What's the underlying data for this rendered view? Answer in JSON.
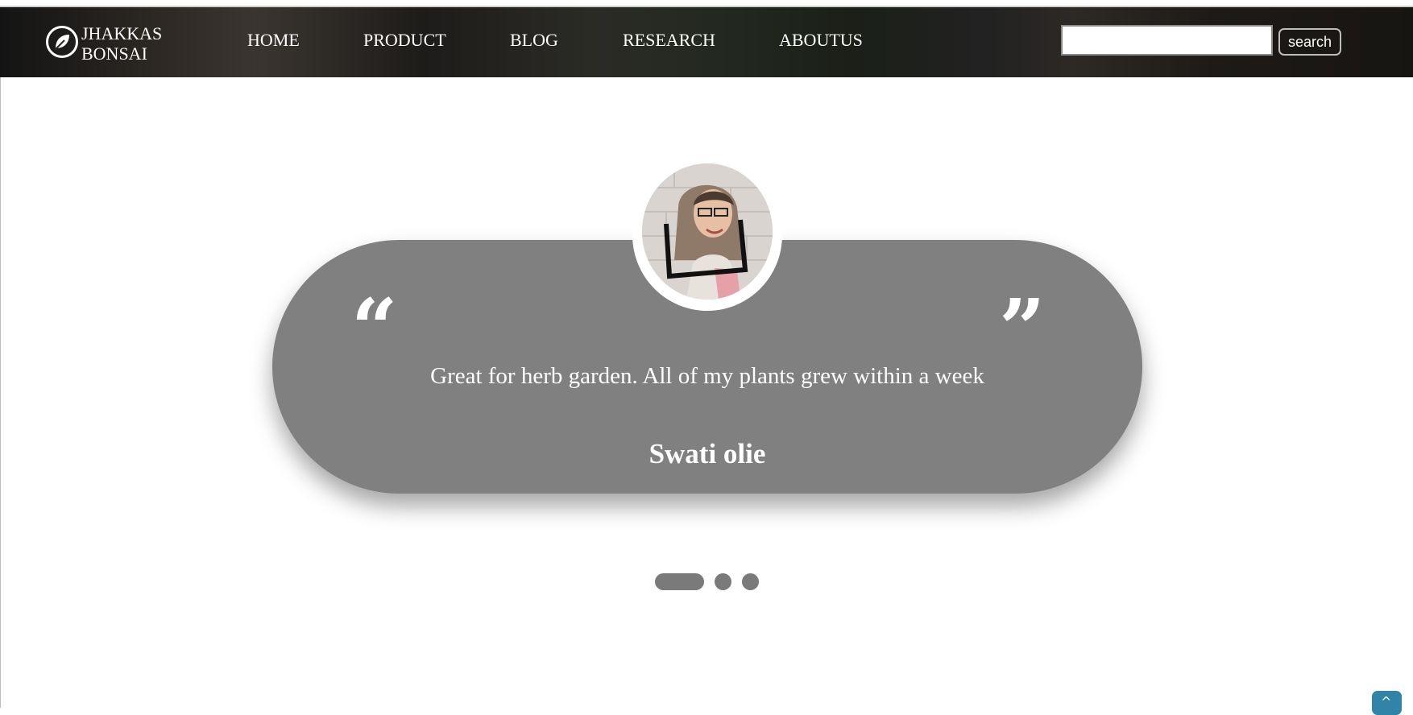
{
  "brand": {
    "line1": "JHAKKAS",
    "line2": "BONSAI"
  },
  "nav": {
    "items": [
      "HOME",
      "PRODUCT",
      "BLOG",
      "RESEARCH",
      "ABOUTUS"
    ]
  },
  "search": {
    "placeholder": "",
    "button_label": "search"
  },
  "testimonial": {
    "quote_open": "“",
    "quote_close": "”",
    "text": "Great for herb garden. All of my plants grew within a week",
    "author": "Swati olie",
    "slides": {
      "total": 3,
      "active_index": 0
    }
  },
  "back_to_top": {
    "icon": "chevron-up-icon",
    "glyph": "^"
  },
  "colors": {
    "card": "#808080",
    "dot": "#7a7a7a",
    "back_to_top": "#2f84a8"
  }
}
